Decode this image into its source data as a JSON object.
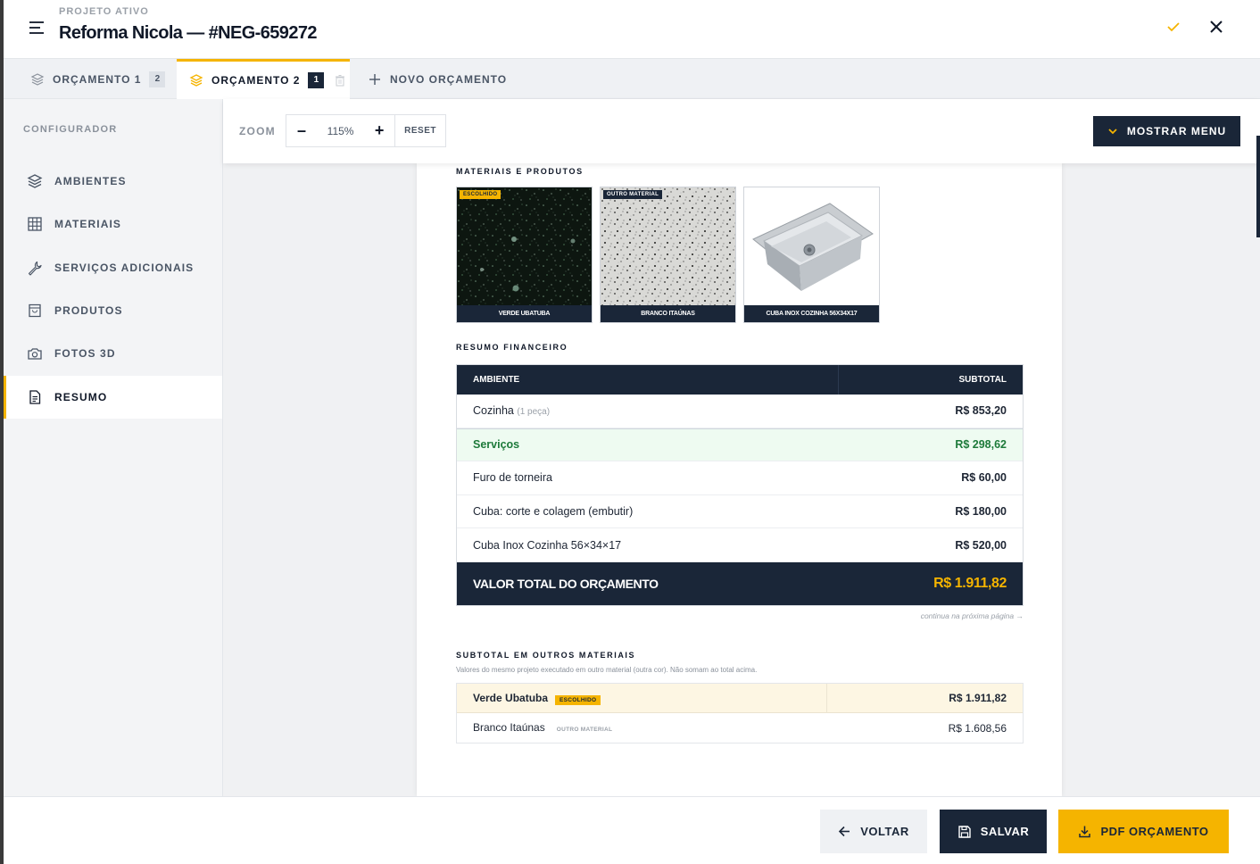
{
  "header": {
    "label": "PROJETO ATIVO",
    "title": "Reforma Nicola — #NEG-659272"
  },
  "tabs": [
    {
      "label": "ORÇAMENTO 1",
      "badge": "2"
    },
    {
      "label": "ORÇAMENTO 2",
      "badge": "1"
    },
    {
      "label": "NOVO ORÇAMENTO"
    }
  ],
  "sidebar": {
    "title": "CONFIGURADOR",
    "items": [
      {
        "label": "AMBIENTES",
        "icon": "layers-icon"
      },
      {
        "label": "MATERIAIS",
        "icon": "grid-icon"
      },
      {
        "label": "SERVIÇOS ADICIONAIS",
        "icon": "wrench-icon"
      },
      {
        "label": "PRODUTOS",
        "icon": "bag-icon"
      },
      {
        "label": "FOTOS 3D",
        "icon": "camera-icon"
      },
      {
        "label": "RESUMO",
        "icon": "document-icon"
      }
    ]
  },
  "toolbar": {
    "zoom_label": "ZOOM",
    "zoom_minus": "–",
    "zoom_value": "115%",
    "zoom_plus": "+",
    "reset_label": "RESET",
    "menu_label": "MOSTRAR MENU"
  },
  "document": {
    "materials_title": "MATERIAIS E PRODUTOS",
    "thumbs": [
      {
        "caption": "VERDE UBATUBA",
        "tag": "ESCOLHIDO"
      },
      {
        "caption": "BRANCO ITAÚNAS",
        "tag": "OUTRO MATERIAL"
      },
      {
        "caption": "CUBA INOX COZINHA 56X34X17"
      }
    ],
    "financial_title": "RESUMO FINANCEIRO",
    "table_head": {
      "col1": "AMBIENTE",
      "col2": "SUBTOTAL"
    },
    "rows": [
      {
        "label": "Cozinha",
        "note": "(1 peça)",
        "value": "R$ 853,20"
      },
      {
        "label": "Serviços",
        "value": "R$ 298,62"
      },
      {
        "label": "Furo de torneira",
        "value": "R$ 60,00"
      },
      {
        "label": "Cuba: corte e colagem (embutir)",
        "value": "R$ 180,00"
      },
      {
        "label": "Cuba Inox Cozinha 56×34×17",
        "value": "R$ 520,00"
      }
    ],
    "total_label": "VALOR TOTAL DO ORÇAMENTO",
    "total_value": "R$ 1.911,82",
    "continue_note": "continua na próxima página →",
    "other_title": "SUBTOTAL EM OUTROS MATERIAIS",
    "other_note": "Valores do mesmo projeto executado em outro material (outra cor). Não somam ao total acima.",
    "other_rows": [
      {
        "label": "Verde Ubatuba",
        "tag": "ESCOLHIDO",
        "value": "R$ 1.911,82"
      },
      {
        "label": "Branco Itaúnas",
        "tag": "OUTRO MATERIAL",
        "value": "R$ 1.608,56"
      }
    ]
  },
  "footer": {
    "back_label": "VOLTAR",
    "save_label": "SALVAR",
    "pdf_label": "PDF ORÇAMENTO"
  },
  "colors": {
    "accent": "#f5b400",
    "navy": "#1a2638",
    "success": "#1d7a3a"
  }
}
